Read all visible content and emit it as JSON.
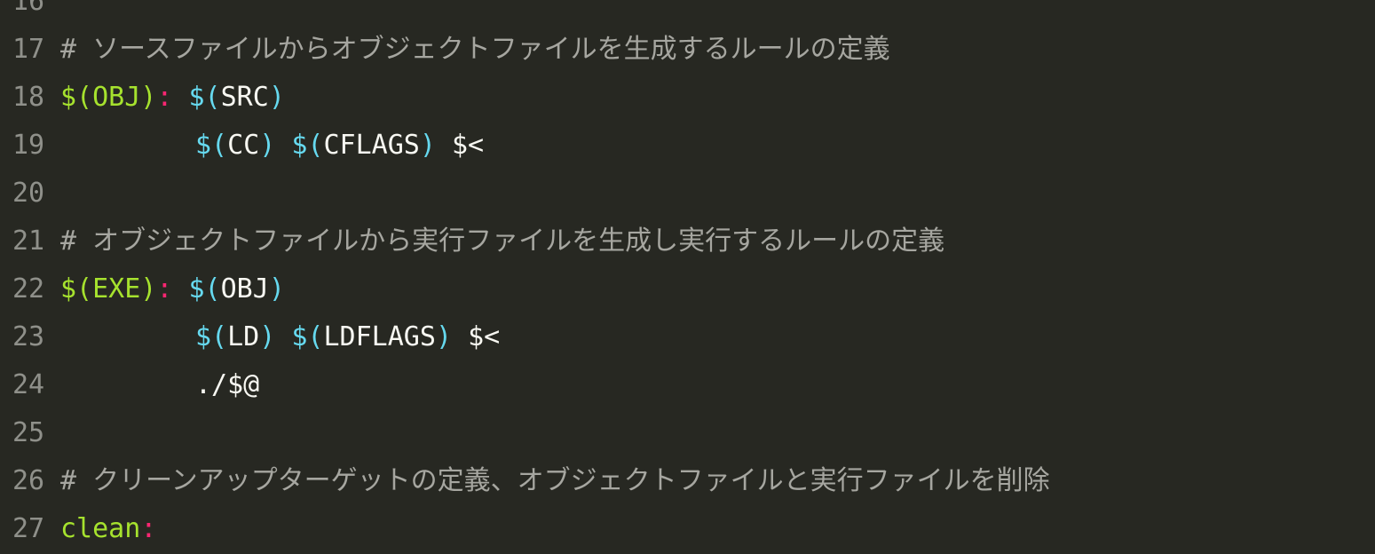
{
  "lines": [
    {
      "num": "16"
    },
    {
      "num": "17",
      "comment": "# ソースファイルからオブジェクトファイルを生成するルールの定義"
    },
    {
      "num": "18",
      "target": "$(OBJ)",
      "colon": ":",
      "dep_open": "$(",
      "dep_name": "SRC",
      "dep_close": ")"
    },
    {
      "num": "19",
      "v1_open": "$(",
      "v1_name": "CC",
      "v1_close": ")",
      "v2_open": "$(",
      "v2_name": "CFLAGS",
      "v2_close": ")",
      "tail": "$<"
    },
    {
      "num": "20"
    },
    {
      "num": "21",
      "comment": "# オブジェクトファイルから実行ファイルを生成し実行するルールの定義"
    },
    {
      "num": "22",
      "target": "$(EXE)",
      "colon": ":",
      "dep_open": "$(",
      "dep_name": "OBJ",
      "dep_close": ")"
    },
    {
      "num": "23",
      "v1_open": "$(",
      "v1_name": "LD",
      "v1_close": ")",
      "v2_open": "$(",
      "v2_name": "LDFLAGS",
      "v2_close": ")",
      "tail": "$<"
    },
    {
      "num": "24",
      "cmd": "./$@"
    },
    {
      "num": "25"
    },
    {
      "num": "26",
      "comment": "# クリーンアップターゲットの定義、オブジェクトファイルと実行ファイルを削除"
    },
    {
      "num": "27",
      "target": "clean",
      "colon": ":"
    }
  ]
}
